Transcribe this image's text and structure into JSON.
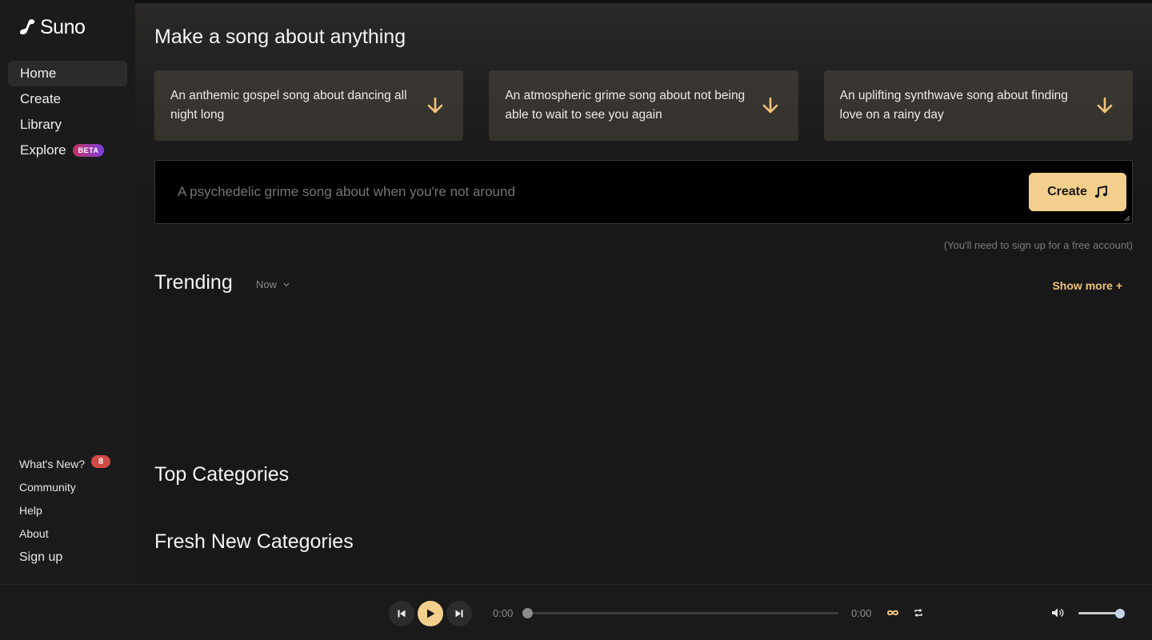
{
  "brand": {
    "name": "Suno"
  },
  "nav": {
    "items": [
      {
        "label": "Home",
        "active": true
      },
      {
        "label": "Create"
      },
      {
        "label": "Library"
      },
      {
        "label": "Explore",
        "badge": "BETA"
      }
    ]
  },
  "footer": {
    "whats_new": {
      "label": "What's New?",
      "count": "8"
    },
    "community": "Community",
    "help": "Help",
    "about": "About",
    "signup": "Sign up"
  },
  "main": {
    "headline": "Make a song about anything",
    "prompts": [
      "An anthemic gospel song about dancing all night long",
      "An atmospheric grime song about not being able to wait to see you again",
      "An uplifting synthwave song about finding love on a rainy day"
    ],
    "input_placeholder": "A psychedelic grime song about when you're not around",
    "create_label": "Create",
    "signup_note": "(You'll need to sign up for a free account)",
    "trending": {
      "title": "Trending",
      "period": "Now",
      "show_more": "Show more +"
    },
    "top_categories": "Top Categories",
    "fresh_categories": "Fresh New Categories"
  },
  "player": {
    "current_time": "0:00",
    "duration": "0:00",
    "progress": 0,
    "volume": 0.9
  },
  "colors": {
    "accent": "#f3cf8d",
    "link": "#eec27b",
    "badge": "#d24a45",
    "background": "#1a1919"
  }
}
